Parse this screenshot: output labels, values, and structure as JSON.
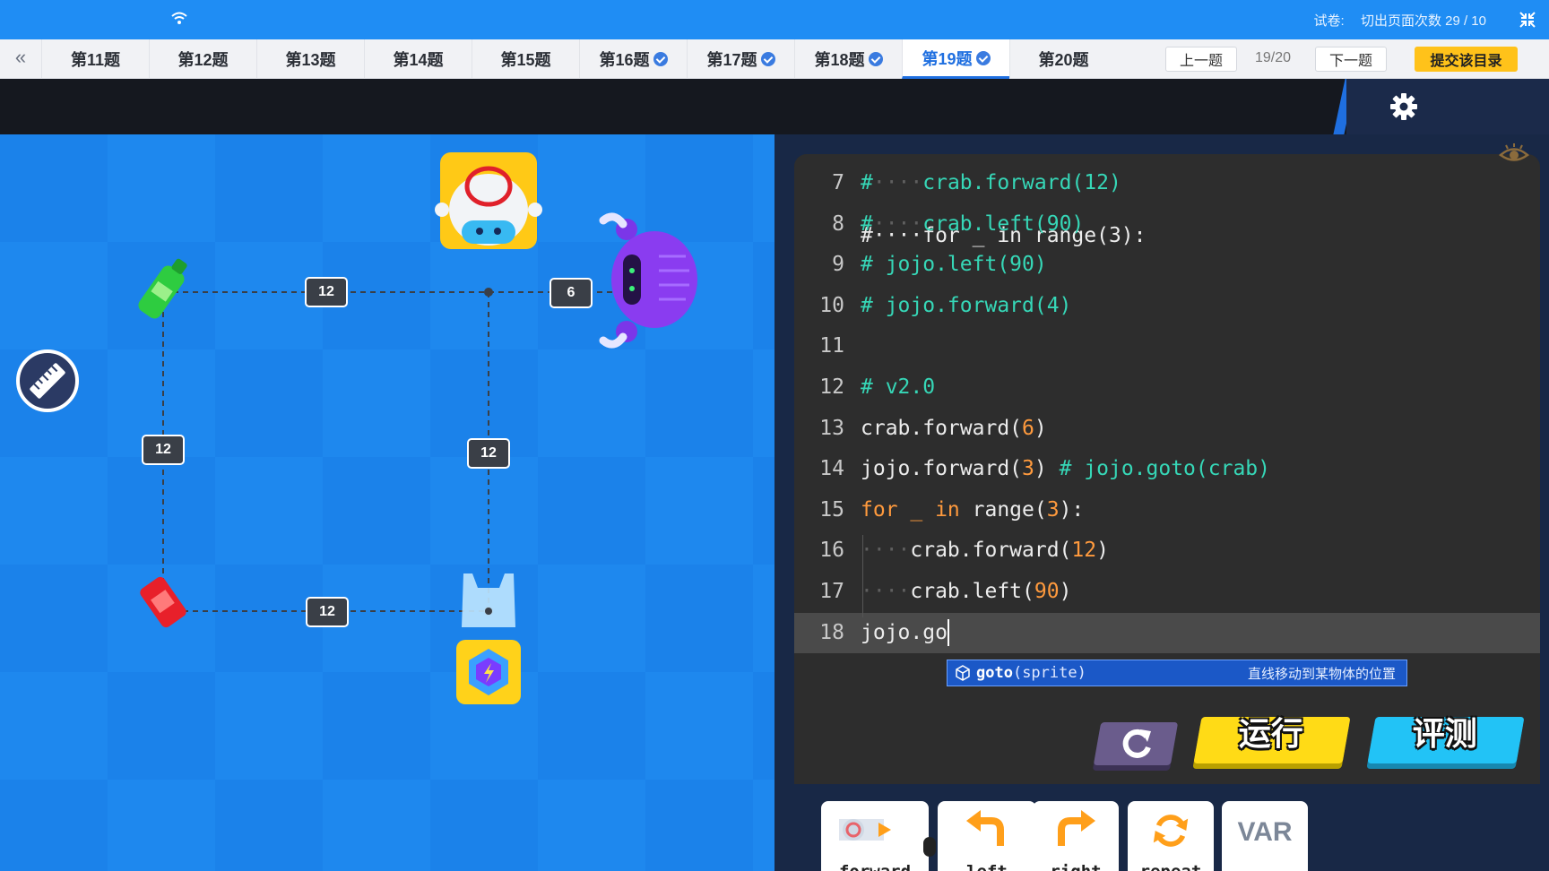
{
  "status_bar": {
    "exam_label": "试卷:",
    "switch_count": "切出页面次数 29 / 10"
  },
  "tabs": {
    "items": [
      {
        "label": "第11题",
        "done": false
      },
      {
        "label": "第12题",
        "done": false
      },
      {
        "label": "第13题",
        "done": false
      },
      {
        "label": "第14题",
        "done": false
      },
      {
        "label": "第15题",
        "done": false
      },
      {
        "label": "第16题",
        "done": true
      },
      {
        "label": "第17题",
        "done": true
      },
      {
        "label": "第18题",
        "done": true
      },
      {
        "label": "第19题",
        "done": true,
        "active": true
      },
      {
        "label": "第20题",
        "done": false
      }
    ],
    "prev": "上一题",
    "page": "19/20",
    "next": "下一题",
    "submit": "提交该目录"
  },
  "field": {
    "labels": [
      "12",
      "6",
      "12",
      "12",
      "12"
    ]
  },
  "editor": {
    "lines": [
      {
        "n": "7",
        "parts": [
          [
            "comment",
            "#"
          ],
          [
            "dots",
            "····"
          ],
          [
            "comment",
            "crab.forward(12)"
          ]
        ]
      },
      {
        "n": "8",
        "parts": [
          [
            "comment",
            "#"
          ],
          [
            "dots",
            "····"
          ],
          [
            "comment",
            "crab.left(90)"
          ]
        ]
      },
      {
        "n": "9",
        "parts": [
          [
            "comment",
            "# jojo.left(90)"
          ]
        ]
      },
      {
        "n": "10",
        "parts": [
          [
            "comment",
            "# jojo.forward(4)"
          ]
        ]
      },
      {
        "n": "11",
        "parts": []
      },
      {
        "n": "12",
        "parts": [
          [
            "comment",
            "# v2.0"
          ]
        ]
      },
      {
        "n": "13",
        "parts": [
          [
            "plain",
            "crab.forward("
          ],
          [
            "num",
            "6"
          ],
          [
            "plain",
            ")"
          ]
        ]
      },
      {
        "n": "14",
        "parts": [
          [
            "plain",
            "jojo.forward("
          ],
          [
            "num",
            "3"
          ],
          [
            "plain",
            ") "
          ],
          [
            "comment",
            "# jojo.goto(crab)"
          ]
        ]
      },
      {
        "n": "15",
        "parts": [
          [
            "kw",
            "for _ in "
          ],
          [
            "plain",
            "range("
          ],
          [
            "num",
            "3"
          ],
          [
            "plain",
            "):"
          ]
        ]
      },
      {
        "n": "16",
        "parts": [
          [
            "dots",
            "····"
          ],
          [
            "plain",
            "crab.forward("
          ],
          [
            "num",
            "12"
          ],
          [
            "plain",
            ")"
          ]
        ]
      },
      {
        "n": "17",
        "parts": [
          [
            "dots",
            "····"
          ],
          [
            "plain",
            "crab.left("
          ],
          [
            "num",
            "90"
          ],
          [
            "plain",
            ")"
          ]
        ]
      },
      {
        "n": "18",
        "parts": [
          [
            "plain",
            "jojo.go"
          ]
        ],
        "current": true
      }
    ],
    "autocomplete": {
      "name": "goto",
      "signature": "(sprite)",
      "description": "直线移动到某物体的位置"
    },
    "run": "运行",
    "evaluate": "评测"
  },
  "palette": {
    "blocks": [
      {
        "label": "forward",
        "icon": "forward-icon"
      },
      {
        "label": "left",
        "icon": "turn-left-icon"
      },
      {
        "label": "right",
        "icon": "turn-right-icon"
      },
      {
        "label": "repeat",
        "icon": "repeat-icon"
      },
      {
        "label": "VAR",
        "icon": "var-icon"
      }
    ]
  }
}
